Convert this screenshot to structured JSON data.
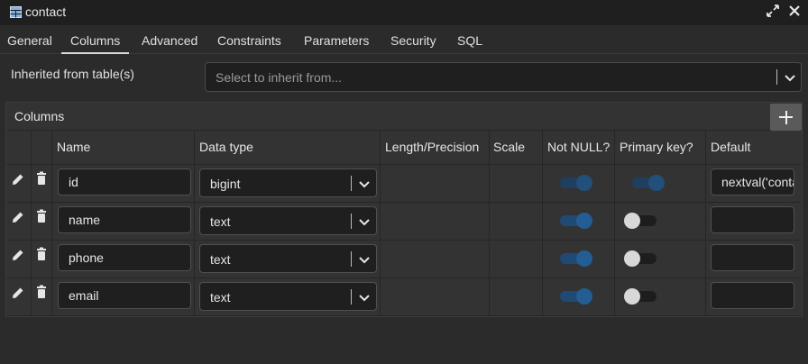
{
  "window": {
    "title": "contact",
    "expand_icon": "expand-icon",
    "close_icon": "close-icon"
  },
  "tabs": [
    {
      "label": "General"
    },
    {
      "label": "Columns"
    },
    {
      "label": "Advanced"
    },
    {
      "label": "Constraints"
    },
    {
      "label": "Parameters"
    },
    {
      "label": "Security"
    },
    {
      "label": "SQL"
    }
  ],
  "active_tab": "Columns",
  "inherit": {
    "label": "Inherited from table(s)",
    "placeholder": "Select to inherit from..."
  },
  "columns_panel": {
    "title": "Columns",
    "headers": [
      "Name",
      "Data type",
      "Length/Precision",
      "Scale",
      "Not NULL?",
      "Primary key?",
      "Default"
    ],
    "rows": [
      {
        "name": "id",
        "data_type": "bigint",
        "not_null": true,
        "primary_key": true,
        "default": "nextval('contact_id_seq'::regclass)"
      },
      {
        "name": "name",
        "data_type": "text",
        "not_null": true,
        "primary_key": false,
        "default": ""
      },
      {
        "name": "phone",
        "data_type": "text",
        "not_null": true,
        "primary_key": false,
        "default": ""
      },
      {
        "name": "email",
        "data_type": "text",
        "not_null": true,
        "primary_key": false,
        "default": ""
      }
    ]
  },
  "colors": {
    "background": "#2b2b2b",
    "toggle_on": "#245d93",
    "toggle_off_knob": "#d8d8d8"
  }
}
